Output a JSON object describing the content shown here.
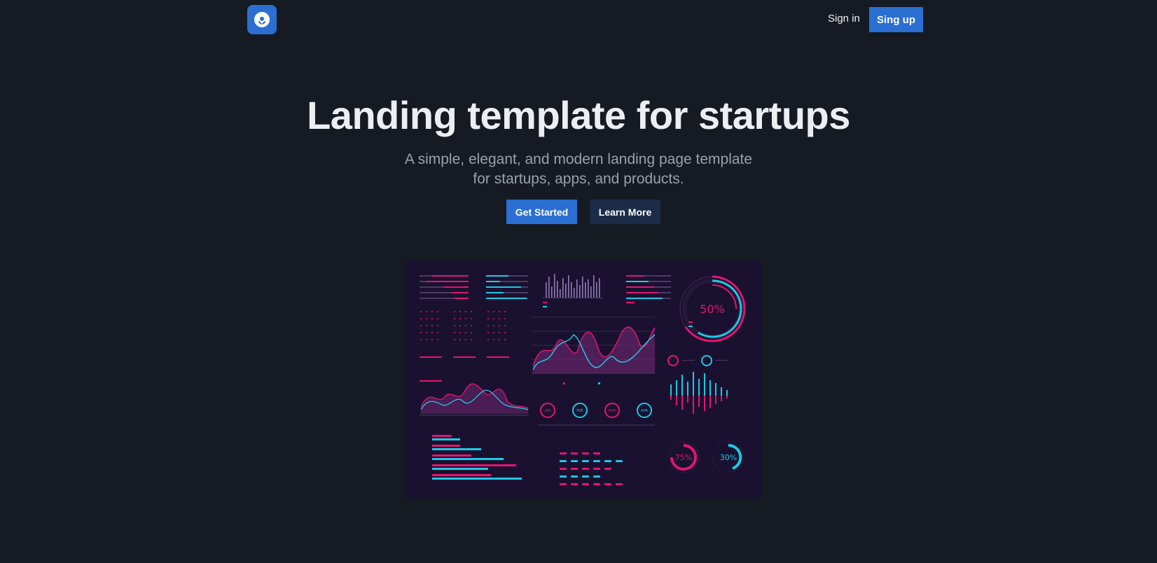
{
  "header": {
    "logo_icon": "leaf-logo-icon",
    "signin_label": "Sign in",
    "signup_label": "Sing up"
  },
  "hero": {
    "title": "Landing template for startups",
    "subtitle": "A simple, elegant, and modern landing page template for startups, apps, and products.",
    "primary_cta": "Get Started",
    "secondary_cta": "Learn More"
  },
  "dashboard_image": {
    "gauge_top": "50%",
    "gauge_left": "75%",
    "gauge_right": "30%",
    "pins": [
      "JAN",
      "FEB",
      "MAR",
      "APR"
    ]
  },
  "colors": {
    "background": "#151a23",
    "accent": "#2a6fd1",
    "secondary_button": "#1c2c48",
    "dash_pink": "#e3156f",
    "dash_cyan": "#1fc8e3"
  }
}
